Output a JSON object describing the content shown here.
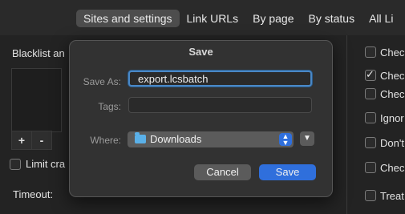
{
  "tabs": [
    "Sites and settings",
    "Link URLs",
    "By page",
    "By status",
    "All Li"
  ],
  "background": {
    "blacklist_label": "Blacklist an",
    "plus": "+",
    "minus": "-",
    "limit_label": "Limit cra",
    "timeout_label": "Timeout:",
    "right_options": [
      {
        "label": "Chec",
        "checked": false
      },
      {
        "label": "Chec",
        "checked": true
      },
      {
        "label": "Chec",
        "checked": false
      },
      {
        "label": "Ignor",
        "checked": false
      },
      {
        "label": "Don't",
        "checked": false
      },
      {
        "label": "Chec",
        "checked": false
      },
      {
        "label": "Treat",
        "checked": false
      }
    ]
  },
  "dialog": {
    "title": "Save",
    "save_as_label": "Save As:",
    "save_as_value": "export.lcsbatch",
    "tags_label": "Tags:",
    "tags_value": "",
    "where_label": "Where:",
    "where_value": "Downloads",
    "cancel": "Cancel",
    "save": "Save"
  },
  "colors": {
    "accent": "#2f6fdc",
    "focus": "#4a88c6",
    "folder": "#5ab0e8"
  },
  "icons": [
    "folder-icon",
    "chevron-updown-icon",
    "chevron-down-icon"
  ]
}
